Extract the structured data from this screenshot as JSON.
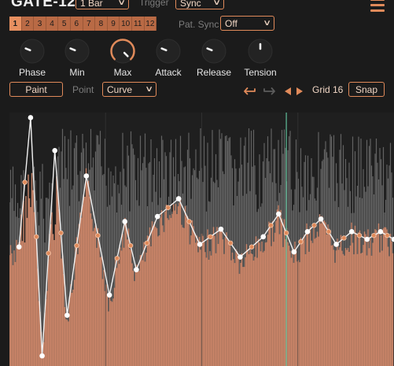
{
  "header": {
    "title": "GATE-12",
    "bars_value": "1 Bar",
    "trigger_label": "Trigger",
    "trigger_value": "Sync"
  },
  "pattern": {
    "steps": [
      "1",
      "2",
      "3",
      "4",
      "5",
      "6",
      "7",
      "8",
      "9",
      "10",
      "11",
      "12"
    ],
    "active_step": 0,
    "pat_sync_label": "Pat. Sync",
    "pat_sync_value": "Off"
  },
  "knobs": [
    {
      "label": "Phase",
      "value": 0.25
    },
    {
      "label": "Min",
      "value": 0.25
    },
    {
      "label": "Max",
      "value": 1.0
    },
    {
      "label": "Attack",
      "value": 0.25
    },
    {
      "label": "Release",
      "value": 0.25
    },
    {
      "label": "Tension",
      "value": 0.5
    }
  ],
  "toolbar": {
    "paint_label": "Paint",
    "point_label": "Point",
    "point_value": "Curve",
    "grid_label": "Grid 16",
    "snap_label": "Snap"
  },
  "colors": {
    "accent": "#e08a5a",
    "wave_fill": "#c98468",
    "wave_gray": "#6e6e6e",
    "playhead": "#5fbf9a",
    "background": "#1b1b1b"
  },
  "icons": {
    "undo": "undo-arrow-icon",
    "redo": "redo-arrow-icon",
    "shift_left": "triangle-left-icon",
    "shift_right": "triangle-right-icon",
    "menu": "hamburger-menu-icon"
  },
  "envelope": {
    "points": [
      [
        0.025,
        0.53
      ],
      [
        0.055,
        0.02
      ],
      [
        0.085,
        0.96
      ],
      [
        0.118,
        0.15
      ],
      [
        0.15,
        0.8
      ],
      [
        0.2,
        0.25
      ],
      [
        0.26,
        0.72
      ],
      [
        0.3,
        0.43
      ],
      [
        0.33,
        0.62
      ],
      [
        0.385,
        0.41
      ],
      [
        0.44,
        0.34
      ],
      [
        0.495,
        0.52
      ],
      [
        0.55,
        0.46
      ],
      [
        0.6,
        0.57
      ],
      [
        0.66,
        0.49
      ],
      [
        0.7,
        0.4
      ],
      [
        0.74,
        0.55
      ],
      [
        0.775,
        0.47
      ],
      [
        0.81,
        0.42
      ],
      [
        0.85,
        0.52
      ],
      [
        0.89,
        0.47
      ],
      [
        0.93,
        0.5
      ],
      [
        0.965,
        0.47
      ],
      [
        1.0,
        0.5
      ]
    ],
    "playhead": 0.72
  }
}
